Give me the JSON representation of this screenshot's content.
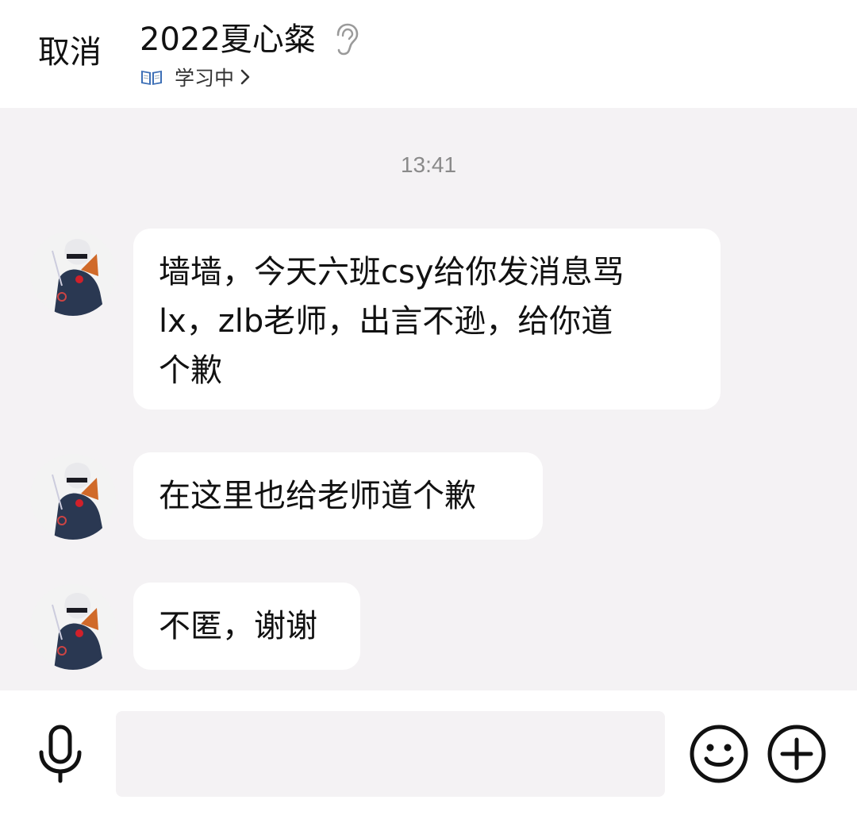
{
  "header": {
    "cancel_label": "取消",
    "title": "2022夏心粲",
    "status_text": "学习中"
  },
  "timestamp": "13:41",
  "messages": [
    {
      "lines": [
        "墙墙，今天六班csy给你发消息骂",
        "lx，zlb老师，出言不逊，给你道",
        "个歉"
      ]
    },
    {
      "lines": [
        "在这里也给老师道个歉"
      ]
    },
    {
      "lines": [
        "不匿，谢谢"
      ]
    }
  ],
  "input": {
    "placeholder": ""
  },
  "icons": {
    "ear": "ear-icon",
    "book": "book-icon",
    "chevron": "chevron-right-icon",
    "mic": "microphone-icon",
    "emoji": "emoji-icon",
    "plus": "plus-icon"
  },
  "colors": {
    "background": "#f4f2f4",
    "bubble": "#ffffff",
    "timestamp": "#8a8a8a"
  }
}
